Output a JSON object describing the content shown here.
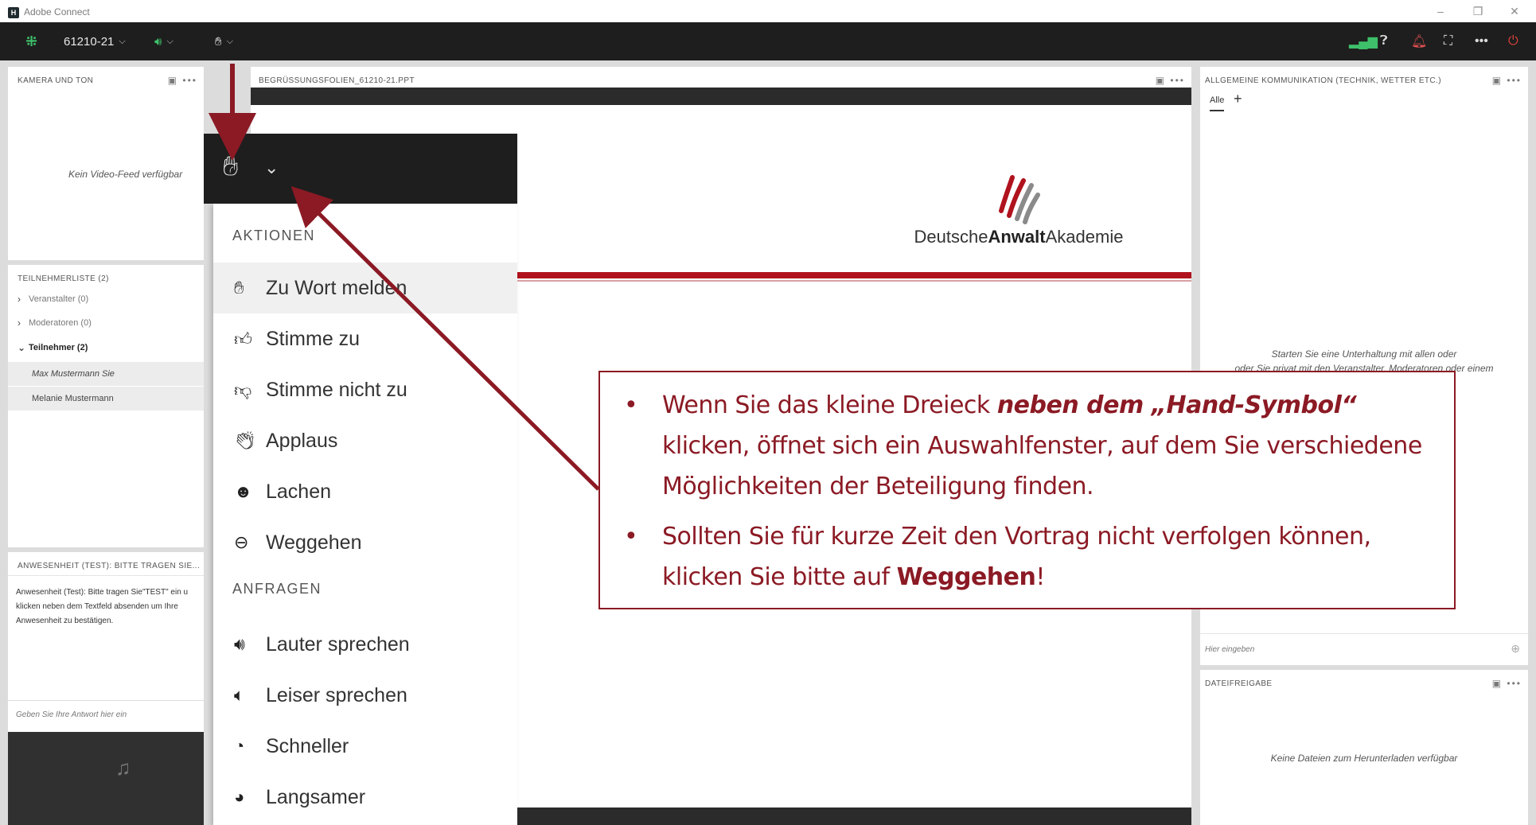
{
  "window": {
    "title": "Adobe Connect",
    "logo_letter": "H"
  },
  "toolbar": {
    "meeting_id": "61210-21"
  },
  "camera_pod": {
    "title": "KAMERA UND TON",
    "empty_text": "Kein Video-Feed verfügbar"
  },
  "participants": {
    "title": "TEILNEHMERLISTE  (2)",
    "groups": [
      {
        "label": "Veranstalter (0)"
      },
      {
        "label": "Moderatoren (0)"
      },
      {
        "label": "Teilnehmer (2)"
      }
    ],
    "members": [
      {
        "name": "Max Mustermann Sie"
      },
      {
        "name": "Melanie Mustermann"
      }
    ]
  },
  "attendance_pod": {
    "title": "ANWESENHEIT (TEST): BITTE TRAGEN SIE...",
    "body": "Anwesenheit (Test): Bitte tragen Sie\"TEST\" ein u klicken neben dem Textfeld absenden um Ihre Anwesenheit zu bestätigen.",
    "body_lines": [
      "Anwesenheit (Test): Bitte tragen Sie\"TEST\" ein u",
      "klicken neben dem Textfeld absenden um Ihre",
      "Anwesenheit zu bestätigen."
    ],
    "input_placeholder": "Geben Sie Ihre Antwort hier ein"
  },
  "slide_pod": {
    "title": "BEGRÜSSUNGSFOLIEN_61210-21.PPT",
    "logo_text_plain_1": "Deutsche",
    "logo_text_bold": "Anwalt",
    "logo_text_plain_2": "Akademie"
  },
  "chat_pod": {
    "title": "ALLGEMEINE KOMMUNIKATION (TECHNIK, WETTER ETC.)",
    "tab_all": "Alle",
    "add_tab": "+",
    "hint_line1": "Starten Sie eine Unterhaltung mit allen oder",
    "hint_line2": "oder Sie privat mit den Veranstalter, Moderatoren oder einem",
    "input_placeholder": "Hier eingeben"
  },
  "files_pod": {
    "title": "DATEIFREIGABE",
    "empty_text": "Keine Dateien zum Herunterladen verfügbar"
  },
  "hand_menu": {
    "section_actions": "AKTIONEN",
    "section_requests": "ANFRAGEN",
    "items": [
      {
        "label": "Zu Wort melden",
        "icon": "hand-raise-icon"
      },
      {
        "label": "Stimme zu",
        "icon": "thumbs-up-icon"
      },
      {
        "label": "Stimme nicht zu",
        "icon": "thumbs-down-icon"
      },
      {
        "label": "Applaus",
        "icon": "applause-icon"
      },
      {
        "label": "Lachen",
        "icon": "laugh-icon"
      },
      {
        "label": "Weggehen",
        "icon": "away-icon"
      },
      {
        "label": "Lauter sprechen",
        "icon": "volume-up-icon"
      },
      {
        "label": "Leiser sprechen",
        "icon": "volume-down-icon"
      },
      {
        "label": "Schneller",
        "icon": "faster-icon"
      },
      {
        "label": "Langsamer",
        "icon": "slower-icon"
      }
    ]
  },
  "callout": {
    "bullet1_part1": "Wenn Sie das kleine Dreieck ",
    "bullet1_emphasis": "neben dem „Hand-Symbol“",
    "bullet1_part2": " klicken, öffnet sich ein Auswahlfenster, auf dem Sie verschiedene Möglichkeiten der Beteiligung finden.",
    "bullet2_part1": "Sollten Sie für kurze Zeit den Vortrag nicht verfolgen können, klicken Sie bitte auf ",
    "bullet2_strong": "Weggehen",
    "bullet2_part2": "!"
  },
  "colors": {
    "accent_red": "#8b1a24",
    "toolbar_bg": "#1e1e1e",
    "green": "#3ec06a"
  }
}
